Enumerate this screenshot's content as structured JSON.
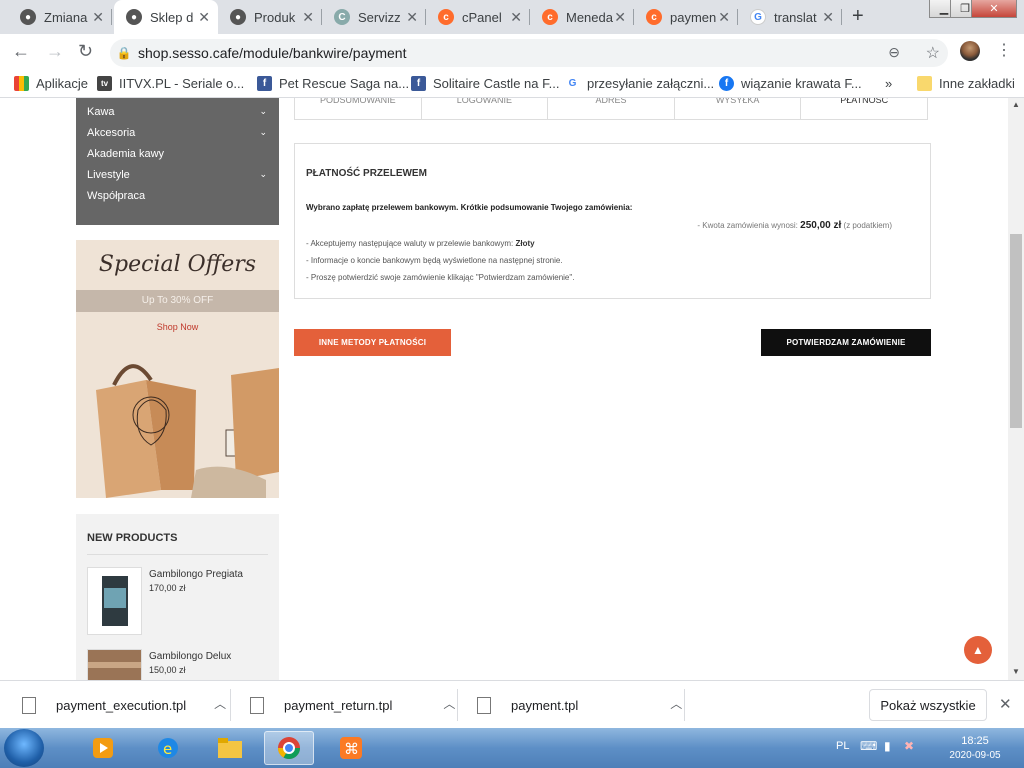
{
  "browser": {
    "tabs": [
      {
        "title": "Zmiana",
        "active": false
      },
      {
        "title": "Sklep d",
        "active": true
      },
      {
        "title": "Produk",
        "active": false
      },
      {
        "title": "Servizz",
        "active": false
      },
      {
        "title": "cPanel",
        "active": false
      },
      {
        "title": "Meneda",
        "active": false
      },
      {
        "title": "paymen",
        "active": false
      },
      {
        "title": "translat",
        "active": false
      }
    ],
    "url": "shop.sesso.cafe/module/bankwire/payment"
  },
  "bookmarks": [
    {
      "label": "Aplikacje",
      "icon": "apps-grid-icon"
    },
    {
      "label": "IITVX.PL - Seriale o...",
      "icon": "tv-icon"
    },
    {
      "label": "Pet Rescue Saga na...",
      "icon": "facebook-icon"
    },
    {
      "label": "Solitaire Castle na F...",
      "icon": "facebook-icon"
    },
    {
      "label": "przesyłanie załączni...",
      "icon": "google-icon"
    },
    {
      "label": "wiązanie krawata F...",
      "icon": "facebook-round-icon"
    }
  ],
  "bookmarks_overflow": "»",
  "bookmarks_other": "Inne zakładki",
  "sidebar": {
    "categories": [
      {
        "label": "Kawa",
        "has_children": true
      },
      {
        "label": "Akcesoria",
        "has_children": true
      },
      {
        "label": "Akademia kawy",
        "has_children": false
      },
      {
        "label": "Livestyle",
        "has_children": true
      },
      {
        "label": "Współpraca",
        "has_children": false
      }
    ],
    "promo": {
      "title": "Special Offers",
      "subtitle": "Up To 30% OFF",
      "link": "Shop Now"
    },
    "new_products": {
      "heading": "NEW PRODUCTS",
      "items": [
        {
          "name": "Gambilongo Pregiata",
          "price": "170,00 zł"
        },
        {
          "name": "Gambilongo Delux",
          "price": "150,00 zł"
        }
      ]
    }
  },
  "checkout_steps": [
    "PODSUMOWANIE",
    "LOGOWANIE",
    "ADRES",
    "WYSYŁKA",
    "PŁATNOŚĆ"
  ],
  "payment": {
    "title": "PŁATNOŚĆ PRZELEWEM",
    "intro": "Wybrano zapłatę przelewem bankowym. Krótkie podsumowanie Twojego zamówienia:",
    "amount_label": "- Kwota zamówienia wynosi:",
    "amount_value": "250,00 zł",
    "amount_note": "(z podatkiem)",
    "currency_line": "- Akceptujemy następujące waluty w przelewie bankowym:",
    "currency_value": "Złoty",
    "info_line": "- Informacje o koncie bankowym będą wyświetlone na następnej stronie.",
    "confirm_line": "- Proszę potwierdzić swoje zamówienie klikając \"Potwierdzam zamówienie\"."
  },
  "buttons": {
    "other_methods": "INNE METODY PŁATNOŚCI",
    "confirm": "POTWIERDZAM ZAMÓWIENIE"
  },
  "downloads": {
    "files": [
      "payment_execution.tpl",
      "payment_return.tpl",
      "payment.tpl"
    ],
    "show_all": "Pokaż wszystkie"
  },
  "taskbar": {
    "language": "PL",
    "time": "18:25",
    "date": "2020-09-05"
  },
  "colors": {
    "accent": "#e4603a",
    "confirm_button": "#0f0f0f",
    "sidebar_menu": "#666666"
  }
}
